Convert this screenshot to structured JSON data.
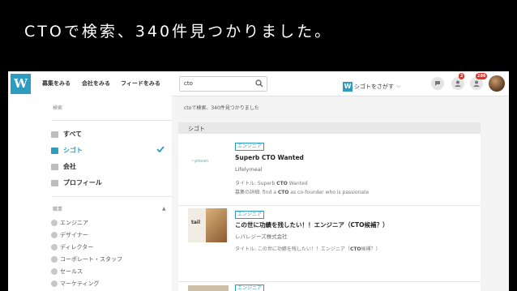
{
  "slide": {
    "title": "CTOで検索、340件見つかりました。"
  },
  "topbar": {
    "logo": "W",
    "nav": [
      "募集をみる",
      "会社をみる",
      "フィードをみる"
    ],
    "search_value": "cto",
    "shigoto_label": "シゴトをさがす",
    "shigoto_chevron": "⌵",
    "notif_badge": "2",
    "profile_badge": "286"
  },
  "sidebar": {
    "heading": "検索",
    "items": [
      {
        "label": "すべて",
        "icon": "grid-icon"
      },
      {
        "label": "シゴト",
        "icon": "briefcase-icon"
      },
      {
        "label": "会社",
        "icon": "building-icon"
      },
      {
        "label": "プロフィール",
        "icon": "person-icon"
      }
    ],
    "category_heading": "職業",
    "category_toggle": "▲",
    "categories": [
      "エンジニア",
      "デザイナー",
      "ディレクター",
      "コーポレート・スタッフ",
      "セールス",
      "マーケティング"
    ]
  },
  "main": {
    "summary": "ctoで検索、340件見つかりました",
    "section": "シゴト",
    "results": [
      {
        "tag": "エンジニア",
        "title": "Superb CTO Wanted",
        "company": "Lifelymeal",
        "thumb_text": "~plovan",
        "desc1_prefix": "タイトル: Superb ",
        "desc1_bold": "CTO",
        "desc1_suffix": " Wanted",
        "desc2_prefix": "募集の詳細: find a ",
        "desc2_bold": "CTO",
        "desc2_suffix": " as co-founder who is passionate"
      },
      {
        "tag": "エンジニア",
        "title": "この世に功績を残したい！！エンジニア（CTO候補？）",
        "company": "レバレジーズ株式会社",
        "thumb_text": "tail",
        "desc1_prefix": "タイトル: この世に功績を残したい！！エンジニア（",
        "desc1_bold": "CTO",
        "desc1_suffix": "候補？）"
      },
      {
        "tag": "エンジニア"
      }
    ]
  }
}
